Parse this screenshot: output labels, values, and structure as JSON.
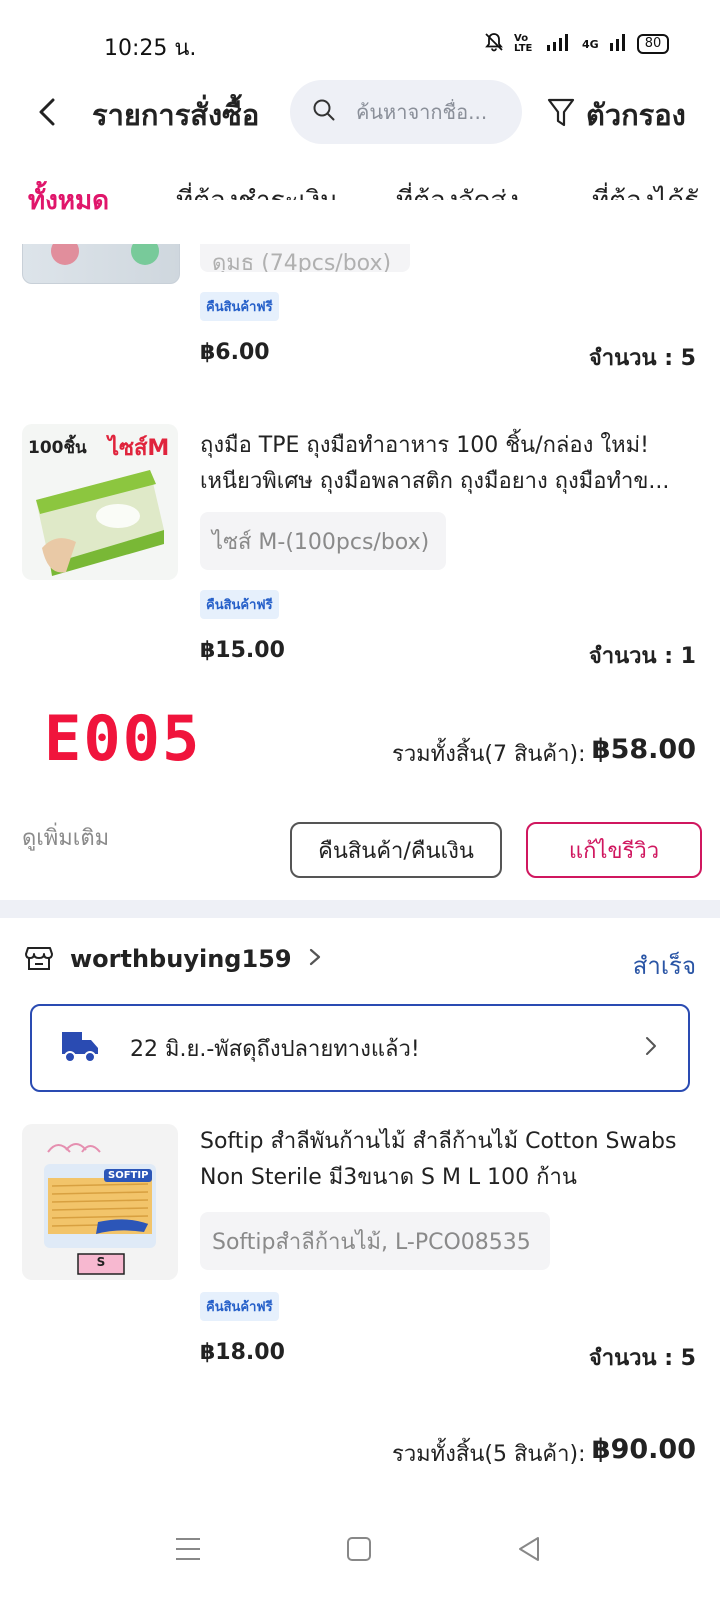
{
  "status_bar": {
    "time": "10:25 น.",
    "volte": "Vo LTE",
    "network": "4G",
    "battery": "80"
  },
  "header": {
    "title": "รายการสั่งซื้อ",
    "search_placeholder": "ค้นหาจากชื่อ...",
    "filter_label": "ตัวกรอง"
  },
  "tabs": [
    {
      "label": "ทั้งหมด",
      "active": true
    },
    {
      "label": "ที่ต้องชำระเงิน"
    },
    {
      "label": "ที่ต้องจัดส่ง"
    },
    {
      "label": "ที่ต้องได้รั"
    }
  ],
  "order1": {
    "item_partial": {
      "variant": "ดุมธ (74pcs/box)",
      "badge": "คืนสินค้าฟรี",
      "price": "฿6.00",
      "qty": "จำนวน : 5"
    },
    "item2": {
      "thumb_text_count": "100ชิ้น",
      "thumb_text_size": "ไซส์M",
      "title": "ถุงมือ TPE ถุงมือทำอาหาร 100 ชิ้น/กล่อง ใหม่! เหนียวพิเศษ ถุงมือพลาสติก ถุงมือยาง ถุงมือทำข...",
      "variant": "ไซส์ M-(100pcs/box)",
      "badge": "คืนสินค้าฟรี",
      "price": "฿15.00",
      "qty": "จำนวน : 1"
    },
    "order_code": "E005",
    "total_label": "รวมทั้งสิ้น(7 สินค้า):",
    "total_value": "฿58.00",
    "see_more": "ดูเพิ่มเติม",
    "return_button": "คืนสินค้า/คืนเงิน",
    "review_button": "แก้ไขรีวิว"
  },
  "order2": {
    "shop_name": "worthbuying159",
    "status": "สำเร็จ",
    "delivery": "22 มิ.ย.-พัสดุถึงปลายทางแล้ว!",
    "item": {
      "thumb_brand": "SOFTIP",
      "thumb_size": "S",
      "title": "Softip สำลีพันก้านไม้ สำลีก้านไม้ Cotton Swabs Non Sterile มี3ขนาด S M L 100 ก้าน",
      "variant": "Softipสำลีก้านไม้, L-PCO08535",
      "badge": "คืนสินค้าฟรี",
      "price": "฿18.00",
      "qty": "จำนวน : 5"
    },
    "total_label": "รวมทั้งสิ้น(5 สินค้า):",
    "total_value": "฿90.00"
  },
  "colors": {
    "accent": "#e0166b",
    "order_code": "#f0143c",
    "link_blue": "#2a55a5",
    "badge_bg": "#e6f0fc"
  }
}
